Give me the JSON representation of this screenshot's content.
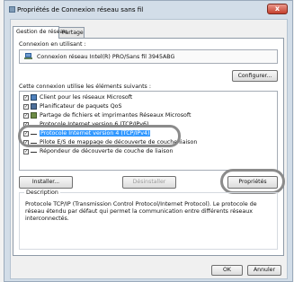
{
  "window": {
    "title": "Propriétés de Connexion réseau sans fil",
    "close_glyph": "x"
  },
  "tabs": [
    {
      "label": "Gestion de réseau",
      "active": true
    },
    {
      "label": "Partage",
      "active": false
    }
  ],
  "connection": {
    "label": "Connexion en utilisant :",
    "adapter": "Connexion réseau Intel(R) PRO/Sans fil 3945ABG",
    "configure_button": "Configurer..."
  },
  "items_label": "Cette connexion utilise les éléments suivants :",
  "items": [
    {
      "label": "Client pour les réseaux Microsoft",
      "icon": "network-client-icon",
      "checked": true
    },
    {
      "label": "Planificateur de paquets QoS",
      "icon": "qos-scheduler-icon",
      "checked": true
    },
    {
      "label": "Partage de fichiers et imprimantes Réseaux Microsoft",
      "icon": "file-sharing-icon",
      "checked": true
    },
    {
      "label": "Protocole Internet version 6 (TCP/IPv6)",
      "icon": "protocol-icon",
      "checked": true
    },
    {
      "label": "Protocole Internet version 4 (TCP/IPv4)",
      "icon": "protocol-icon",
      "checked": true,
      "selected": true
    },
    {
      "label": "Pilote E/S de mappage de découverte de couche liaison",
      "icon": "protocol-icon",
      "checked": true
    },
    {
      "label": "Répondeur de découverte de couche de liaison",
      "icon": "protocol-icon",
      "checked": true
    }
  ],
  "actions": {
    "install": "Installer...",
    "uninstall": "Désinstaller",
    "properties": "Propriétés"
  },
  "description": {
    "title": "Description",
    "text": "Protocole TCP/IP (Transmission Control Protocol/Internet Protocol). Le protocole de réseau étendu par défaut qui permet la communication entre différents réseaux interconnectés."
  },
  "footer": {
    "ok": "OK",
    "cancel": "Annuler"
  },
  "highlight_color": "#3399ff",
  "annotation_ring_color": "#8b8b8b"
}
